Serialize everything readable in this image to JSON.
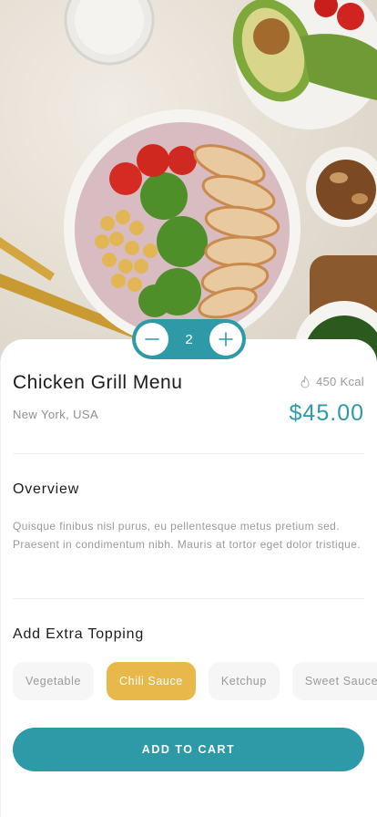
{
  "product": {
    "title": "Chicken Grill Menu",
    "calories": "450 Kcal",
    "location": "New York, USA",
    "price": "$45.00",
    "quantity": "2"
  },
  "overview": {
    "heading": "Overview",
    "text": "Quisque finibus nisl purus, eu pellentesque metus pretium sed. Praesent in condimentum nibh. Mauris at tortor eget dolor tristique."
  },
  "toppings": {
    "heading": "Add Extra Topping",
    "items": [
      "Vegetable",
      "Chili Sauce",
      "Ketchup",
      "Sweet Sauce"
    ],
    "selected": "Chili Sauce"
  },
  "cart": {
    "label": "ADD TO CART"
  },
  "icons": {
    "decrease": "minus-icon",
    "increase": "plus-icon",
    "calories": "flame-icon"
  },
  "colors": {
    "accent": "#2e9aa8",
    "selected_chip": "#e9b84a"
  }
}
